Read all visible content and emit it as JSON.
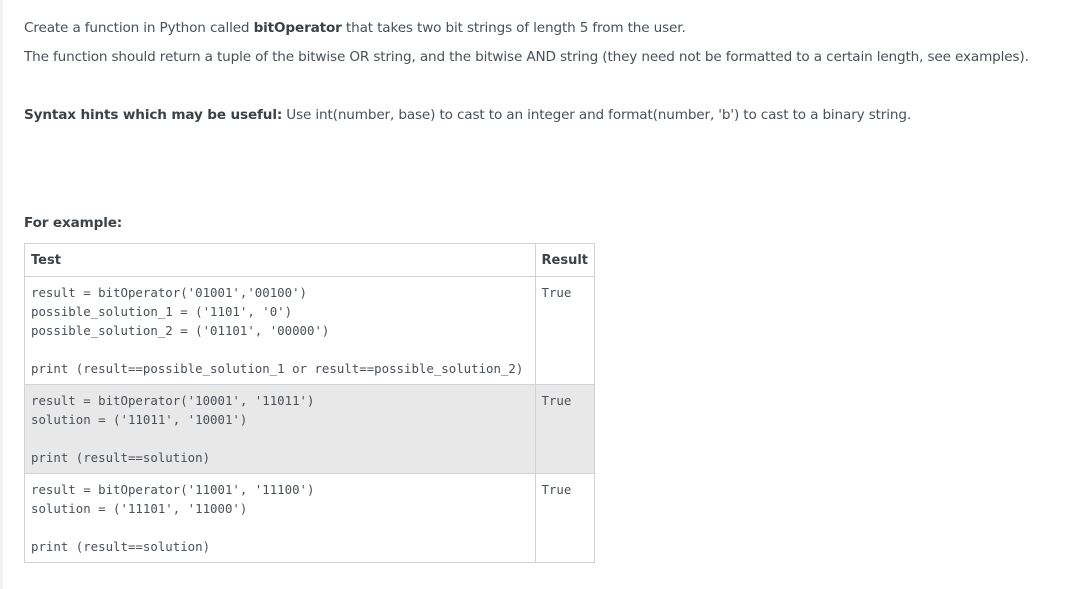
{
  "question": {
    "line1_prefix": "Create a function in Python called ",
    "line1_bold": "bitOperator",
    "line1_suffix": " that takes two bit strings of length 5 from the user.",
    "line2": "The function should return a tuple of the bitwise OR string, and the bitwise AND string (they need not be formatted to a certain length, see examples).",
    "hint_bold": "Syntax hints which may be useful:",
    "hint_text": " Use int(number, base) to cast to an integer and format(number, 'b') to cast to a binary string."
  },
  "examples": {
    "heading": "For example:",
    "header_test": "Test",
    "header_result": "Result",
    "rows": [
      {
        "lines": [
          "result = bitOperator('01001','00100')",
          "possible_solution_1 = ('1101', '0')",
          "possible_solution_2 = ('01101', '00000')",
          "",
          "print (result==possible_solution_1 or result==possible_solution_2)"
        ],
        "result": "True"
      },
      {
        "lines": [
          "result = bitOperator('10001', '11011')",
          "solution = ('11011', '10001')",
          "",
          "print (result==solution)"
        ],
        "result": "True"
      },
      {
        "lines": [
          "result = bitOperator('11001', '11100')",
          "solution = ('11101', '11000')",
          "",
          "print (result==solution)"
        ],
        "result": "True"
      }
    ]
  }
}
